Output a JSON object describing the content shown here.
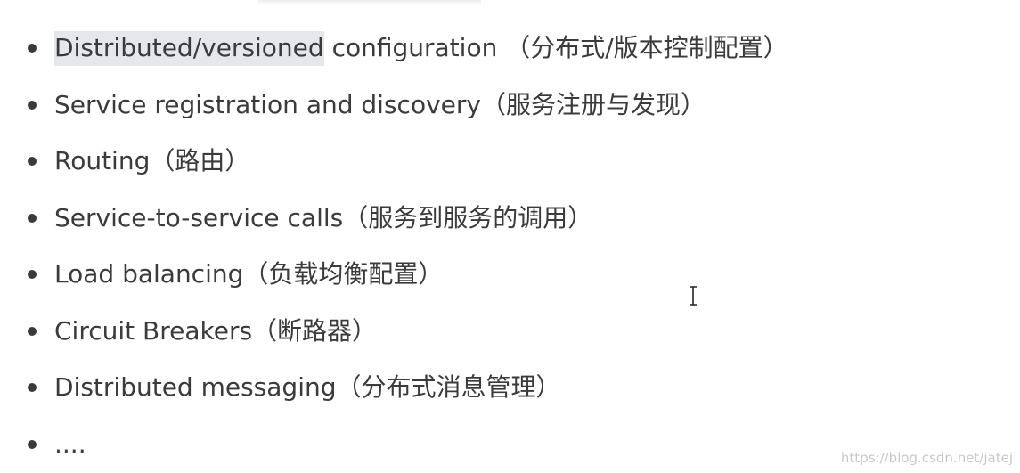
{
  "list": {
    "items": [
      {
        "highlight": "Distributed/versioned",
        "text": " configuration （分布式/版本控制配置）"
      },
      {
        "text": "Service registration and discovery（服务注册与发现）"
      },
      {
        "text": "Routing（路由）"
      },
      {
        "text": "Service-to-service calls（服务到服务的调用）"
      },
      {
        "text": "Load balancing（负载均衡配置）"
      },
      {
        "text": "Circuit Breakers（断路器）"
      },
      {
        "text": "Distributed messaging（分布式消息管理）"
      },
      {
        "text": "...."
      }
    ]
  },
  "watermark": "https://blog.csdn.net/jatej"
}
